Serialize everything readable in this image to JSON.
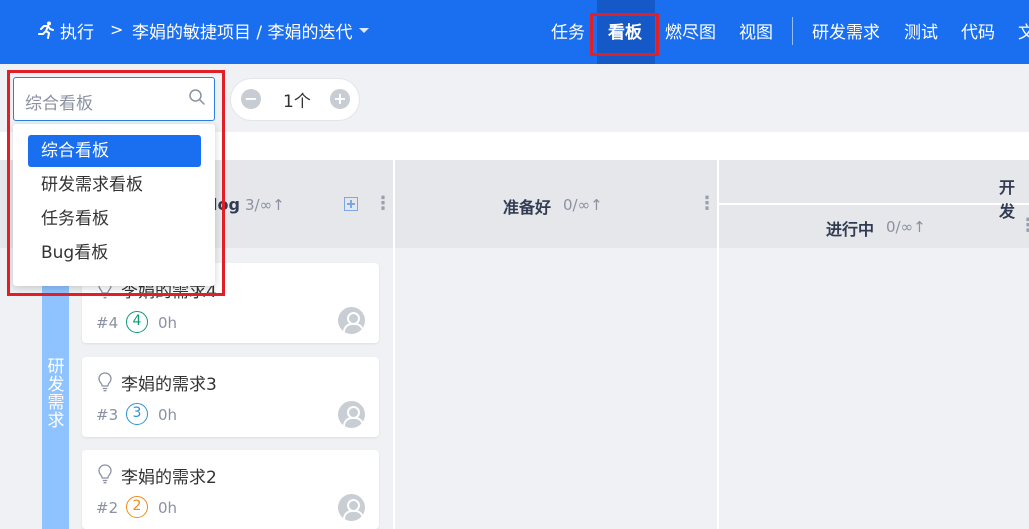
{
  "topbar": {
    "run_label": "执行",
    "crumb_sep": ">",
    "project": "李娟的敏捷项目 / 李娟的迭代",
    "nav": {
      "task": "任务",
      "kanban": "看板",
      "burndown": "燃尽图",
      "view": "视图",
      "requirement": "研发需求",
      "test": "测试",
      "code": "代码",
      "doc": "文"
    }
  },
  "toolbar": {
    "minus": "−",
    "count": "1个",
    "plus": "+"
  },
  "board": {
    "backlog_title": "log",
    "backlog_limit": "3/∞↑",
    "ready_title": "准备好",
    "ready_limit": "0/∞↑",
    "dev_title": "开发",
    "doing_title": "进行中",
    "doing_limit": "0/∞↑",
    "kebab": "⋮",
    "lane_label": "研发需求",
    "cards": [
      {
        "title": "李娟的需求4",
        "id": "#4",
        "priority": "4",
        "hours": "0h",
        "pri_color": "#0c9a78"
      },
      {
        "title": "李娟的需求3",
        "id": "#3",
        "priority": "3",
        "hours": "0h",
        "pri_color": "#2994d6"
      },
      {
        "title": "李娟的需求2",
        "id": "#2",
        "priority": "2",
        "hours": "0h",
        "pri_color": "#f08c16"
      }
    ]
  },
  "dropdown": {
    "search_placeholder": "综合看板",
    "items": [
      "综合看板",
      "研发需求看板",
      "任务看板",
      "Bug看板"
    ],
    "active_index": 0
  },
  "colors": {
    "brand": "#1a6ef0",
    "highlight": "#e01f26",
    "lane": "#8fc3ff"
  }
}
